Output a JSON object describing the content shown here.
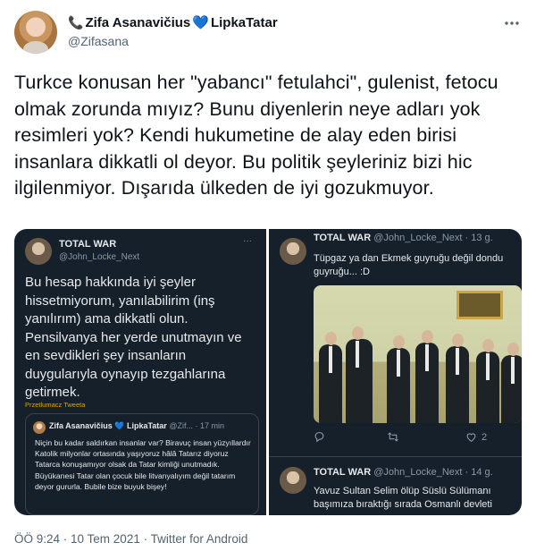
{
  "author": {
    "name_prefix": "📞",
    "name_first": "Zifa Asanavičius",
    "name_heart": "💙",
    "name_last": "LipkaTatar",
    "handle": "@Zifasana"
  },
  "tweet": {
    "text": "Turkce konusan her \"yabancı\" fetulahci\", gulenist, fetocu olmak zorunda mıyız? Bunu diyenlerin neye adları yok resimleri yok? Kendi hukumetine de alay eden birisi insanlara dikkatli ol deyor. Bu politik şeyleriniz bizi hic ilgilenmiyor. Dışarıda ülkeden de iyi gozukmuyor.",
    "meta": "ÖÖ 9:24 · 10 Tem 2021 · Twitter for Android"
  },
  "icons": {
    "more": "more-dots-icon",
    "reply": "reply-icon",
    "retweet": "retweet-icon",
    "like": "heart-icon"
  },
  "left_panel": {
    "name": "TOTAL WAR",
    "handle": "@John_Locke_Next",
    "more": "···",
    "text": "Bu hesap hakkında iyi şeyler hissetmiyorum, yanılabilirim (inş yanılırım) ama dikkatli olun. Pensilvanya her yerde unutmayın ve en sevdikleri şey insanların duygularıyla oynayıp tezgahlarına getirmek.",
    "translate": "Przetlumacz Tweeta",
    "quote": {
      "name": "Zifa Asanavičius",
      "heart": "💙",
      "name2": "LipkaTatar",
      "handle": "@Zif...",
      "time": "· 17 min",
      "text": "Niçin bu kadar saldırkan insanlar var? Biravuç insan yüzyıllardır Katolik milyonlar ortasında yaşıyoruz hâlâ Tatarız diyoruz Tatarca konuşamıyor olsak da Tatar kimliği unutmadık. Büyükanesi Tatar olan çocuk bile litvanyalıyım değil tatarım deyor gururla. Bubile bize buyuk bişey!"
    }
  },
  "right_panel": {
    "tweet1": {
      "name": "TOTAL WAR",
      "handle": "@John_Locke_Next · 13 g.",
      "text": "Tüpgaz ya dan Ekmek guyruğu değil dondu guyruğu... :D",
      "likes": "2"
    },
    "tweet2": {
      "name": "TOTAL WAR",
      "handle": "@John_Locke_Next · 14 g.",
      "text_line1": "Yavuz Sultan Selim ölüp Süslü Sülümanı",
      "text_line2": "başımıza bıraktığı sırada Osmanlı devleti"
    }
  }
}
